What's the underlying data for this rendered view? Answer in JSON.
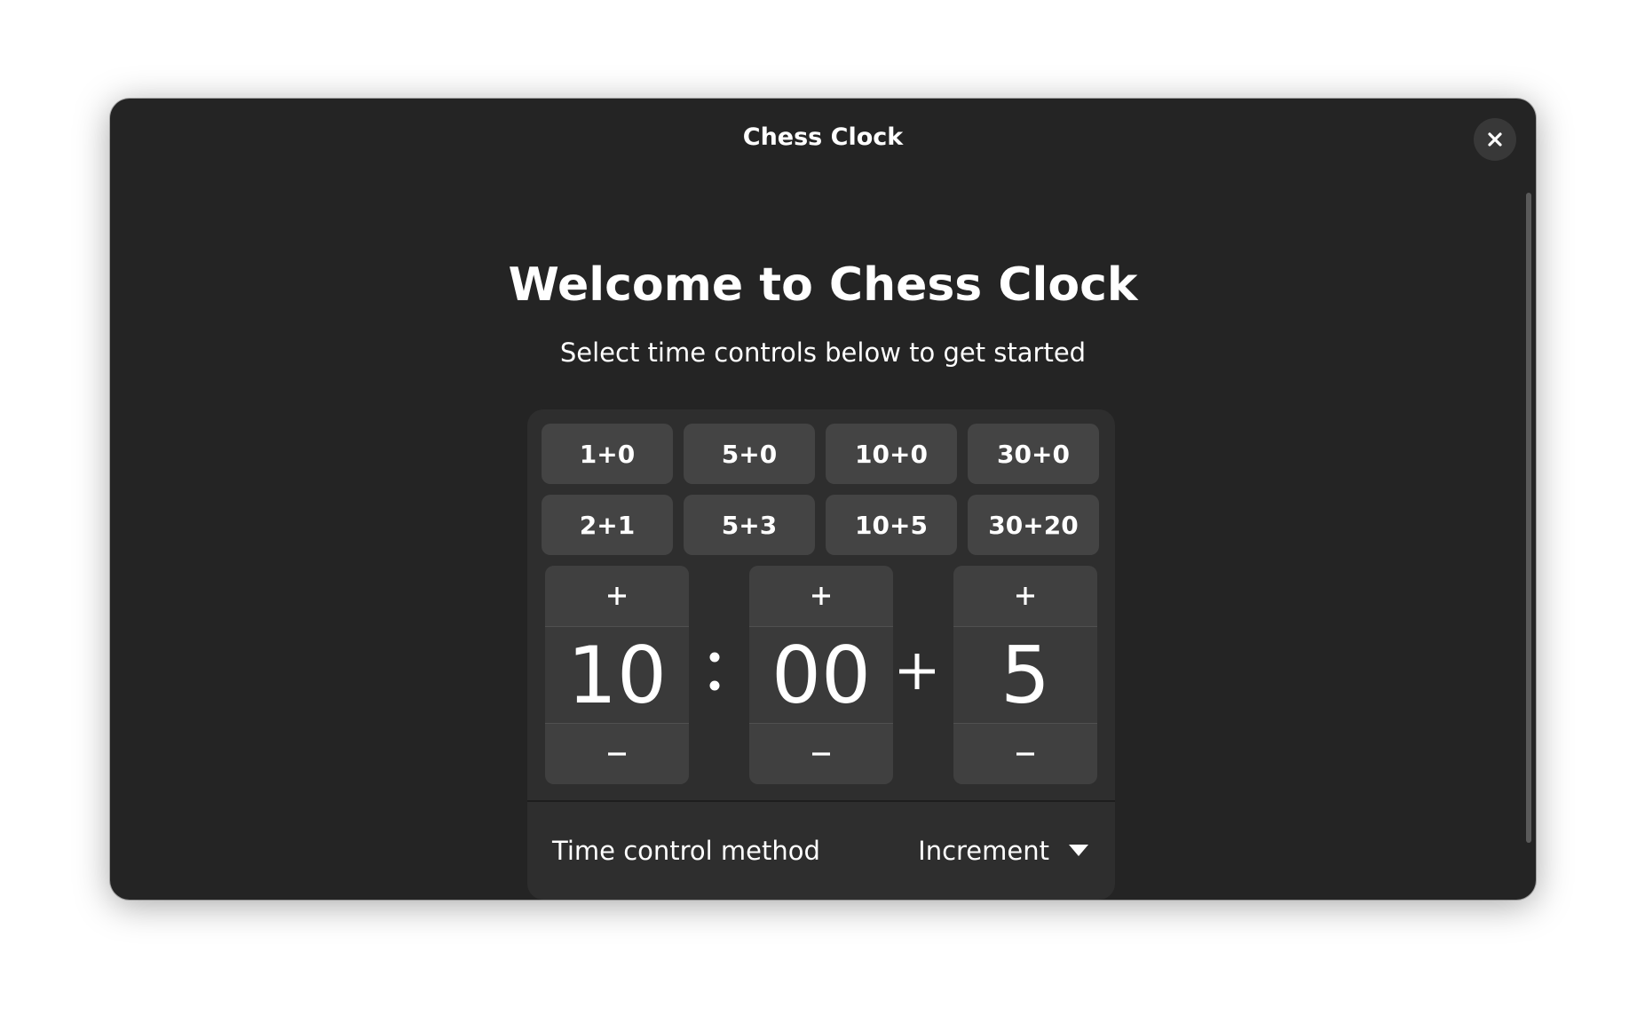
{
  "window": {
    "title": "Chess Clock"
  },
  "welcome": {
    "heading": "Welcome to Chess Clock",
    "subheading": "Select time controls below to get started"
  },
  "presets": [
    {
      "label": "1+0"
    },
    {
      "label": "5+0"
    },
    {
      "label": "10+0"
    },
    {
      "label": "30+0"
    },
    {
      "label": "2+1"
    },
    {
      "label": "5+3"
    },
    {
      "label": "10+5"
    },
    {
      "label": "30+20"
    }
  ],
  "time_control": {
    "minutes": "10",
    "separator": ":",
    "seconds": "00",
    "plus": "+",
    "increment": "5",
    "increase_symbol": "+",
    "decrease_symbol": "−"
  },
  "method_row": {
    "label": "Time control method",
    "value": "Increment"
  },
  "icons": {
    "close": "close-icon",
    "dropdown": "chevron-down-icon"
  },
  "colors": {
    "window_bg": "#242424",
    "card_bg": "#2e2e2e",
    "button_bg": "#444444",
    "text": "#ffffff"
  }
}
